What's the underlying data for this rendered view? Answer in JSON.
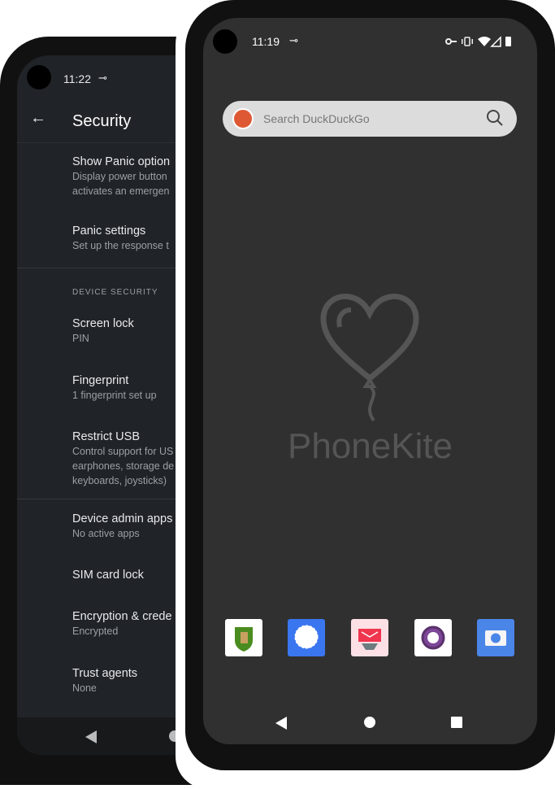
{
  "settings_phone": {
    "status": {
      "time": "11:22"
    },
    "header": {
      "title": "Security"
    },
    "items": [
      {
        "title": "Show Panic option",
        "subtitle": [
          "Display power button",
          "activates an emergen"
        ]
      },
      {
        "title": "Panic settings",
        "subtitle": [
          "Set up the response t"
        ]
      },
      {
        "title": "Screen lock",
        "subtitle": [
          "PIN"
        ]
      },
      {
        "title": "Fingerprint",
        "subtitle": [
          "1 fingerprint set up"
        ]
      },
      {
        "title": "Restrict USB",
        "subtitle": [
          "Control support for US",
          "earphones, storage de",
          "keyboards, joysticks)"
        ]
      },
      {
        "title": "Device admin apps",
        "subtitle": [
          "No active apps"
        ]
      },
      {
        "title": "SIM card lock",
        "subtitle": []
      },
      {
        "title": "Encryption & crede",
        "subtitle": [
          "Encrypted"
        ]
      },
      {
        "title": "Trust agents",
        "subtitle": [
          "None"
        ]
      }
    ],
    "section": "DEVICE SECURITY"
  },
  "home_phone": {
    "status": {
      "time": "11:19",
      "icons": [
        "vpn-key-icon",
        "vibrate-icon",
        "wifi-icon",
        "signal-icon",
        "battery-icon"
      ]
    },
    "search": {
      "placeholder": "Search DuckDuckGo"
    },
    "brand": "PhoneKite",
    "dock": [
      "Guardian app",
      "Signal",
      "K-9 Mail",
      "Tor Browser",
      "Camera"
    ]
  }
}
